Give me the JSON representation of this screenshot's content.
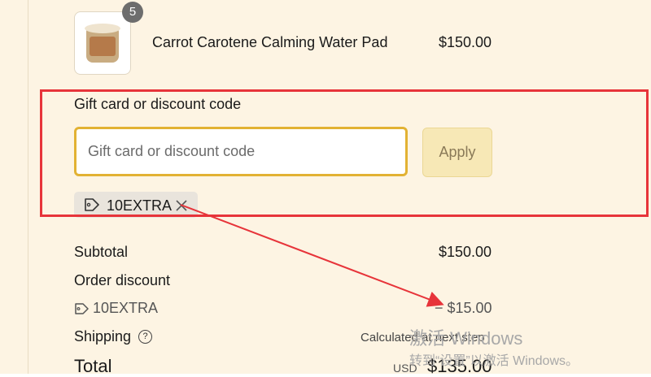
{
  "product": {
    "name": "Carrot Carotene Calming Water Pad",
    "price": "$150.00",
    "quantity": "5",
    "image_icon": "product-jar-image"
  },
  "discount": {
    "heading": "Gift card or discount code",
    "input_placeholder": "Gift card or discount code",
    "input_value": "",
    "apply_label": "Apply",
    "applied_code": "10EXTRA",
    "chip_icon": "tag-icon",
    "remove_icon": "close-icon"
  },
  "summary": {
    "subtotal_label": "Subtotal",
    "subtotal_value": "$150.00",
    "order_discount_label": "Order discount",
    "discount_code": "10EXTRA",
    "discount_value": "− $15.00",
    "shipping_label": "Shipping",
    "shipping_value": "Calculated at next step",
    "total_label": "Total",
    "currency": "USD",
    "total_value": "$135.00"
  },
  "watermark": {
    "line1": "激活 Windows",
    "line2": "转到“设置”以激活 Windows。"
  },
  "colors": {
    "panel_bg": "#fdf4e3",
    "annotation_red": "#e7343a",
    "input_focus": "#e2b233",
    "apply_bg": "#f7e8b6"
  }
}
